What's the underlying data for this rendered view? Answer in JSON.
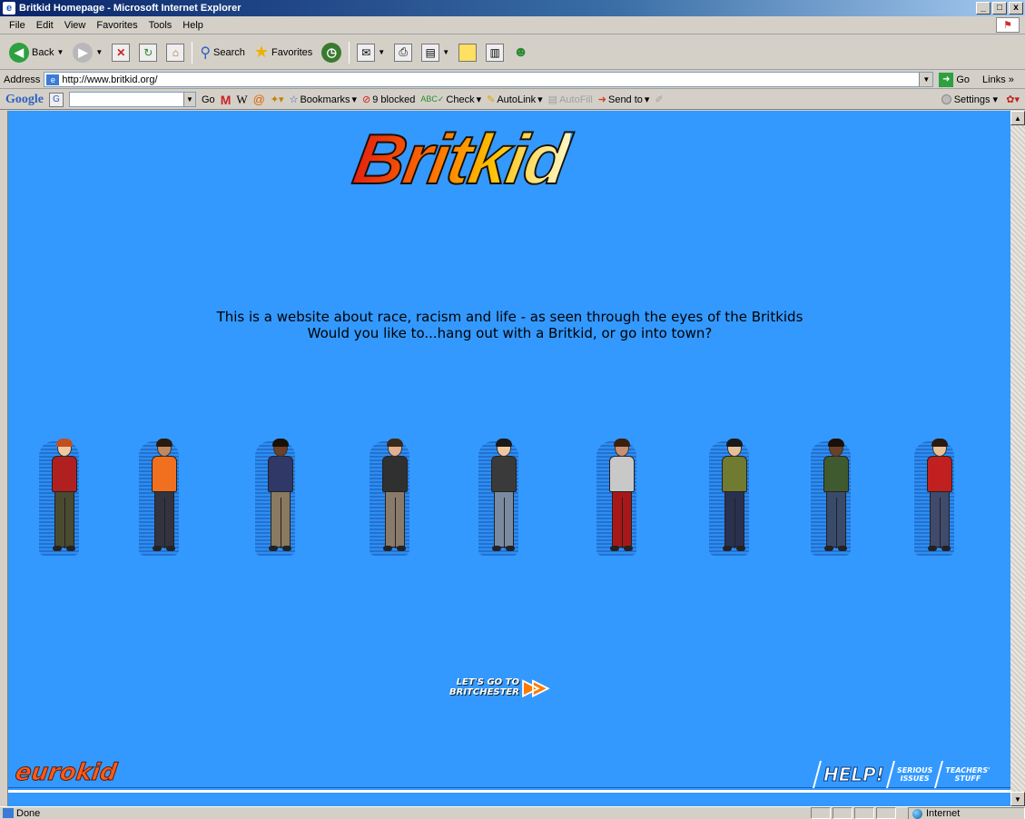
{
  "window": {
    "title": "Britkid Homepage - Microsoft Internet Explorer",
    "controls": [
      "_",
      "□",
      "x"
    ]
  },
  "menu": [
    "File",
    "Edit",
    "View",
    "Favorites",
    "Tools",
    "Help"
  ],
  "toolbar": {
    "back_label": "Back",
    "search_label": "Search",
    "favorites_label": "Favorites"
  },
  "address": {
    "label": "Address",
    "url": "http://www.britkid.org/",
    "go_label": "Go",
    "links_label": "Links"
  },
  "google_toolbar": {
    "logo": "Google",
    "go_label": "Go",
    "bookmarks_label": "Bookmarks",
    "blocked_label": "9 blocked",
    "check_label": "Check",
    "autolink_label": "AutoLink",
    "autofill_label": "AutoFill",
    "sendto_label": "Send to",
    "settings_label": "Settings"
  },
  "page": {
    "logo_text": "Britkid",
    "tagline_line1": "This is a website about race, racism and life - as seen through the eyes of the Britkids",
    "tagline_line2": "Would you like to...hang out with a Britkid, or go into town?",
    "britchester_line1": "LET'S GO TO",
    "britchester_line2": "BRITCHESTER",
    "eurokid_label": "eurokid",
    "help_label": "HELP!",
    "serious_issues_line1": "SERIOUS",
    "serious_issues_line2": "ISSUES",
    "teachers_stuff_line1": "TEACHERS'",
    "teachers_stuff_line2": "STUFF",
    "kids": [
      {
        "name": "kid-1",
        "top": "#b02020",
        "legs": "#4a4a30",
        "hair": "#c05020",
        "skin": "#f0c8a0"
      },
      {
        "name": "kid-2",
        "top": "#f07020",
        "legs": "#333340",
        "hair": "#2a1a10",
        "skin": "#c08860"
      },
      {
        "name": "kid-3",
        "top": "#303868",
        "legs": "#8a7a60",
        "hair": "#1a1008",
        "skin": "#6a4028"
      },
      {
        "name": "kid-4",
        "top": "#303030",
        "legs": "#8a7a6a",
        "hair": "#3a2a1a",
        "skin": "#e0b090"
      },
      {
        "name": "kid-5",
        "top": "#3a3a3a",
        "legs": "#7a8aa0",
        "hair": "#1a1a1a",
        "skin": "#f0c8a0"
      },
      {
        "name": "kid-6",
        "top": "#c8c8c8",
        "legs": "#a81818",
        "hair": "#3a2010",
        "skin": "#c89070"
      },
      {
        "name": "kid-7",
        "top": "#707a30",
        "legs": "#2a3050",
        "hair": "#1a1a1a",
        "skin": "#e8c098"
      },
      {
        "name": "kid-8",
        "top": "#405a30",
        "legs": "#3a4a6a",
        "hair": "#1a1008",
        "skin": "#6a4028"
      },
      {
        "name": "kid-9",
        "top": "#c02020",
        "legs": "#404a6a",
        "hair": "#2a1a10",
        "skin": "#e8c098"
      }
    ]
  },
  "status": {
    "text": "Done",
    "zone": "Internet"
  }
}
